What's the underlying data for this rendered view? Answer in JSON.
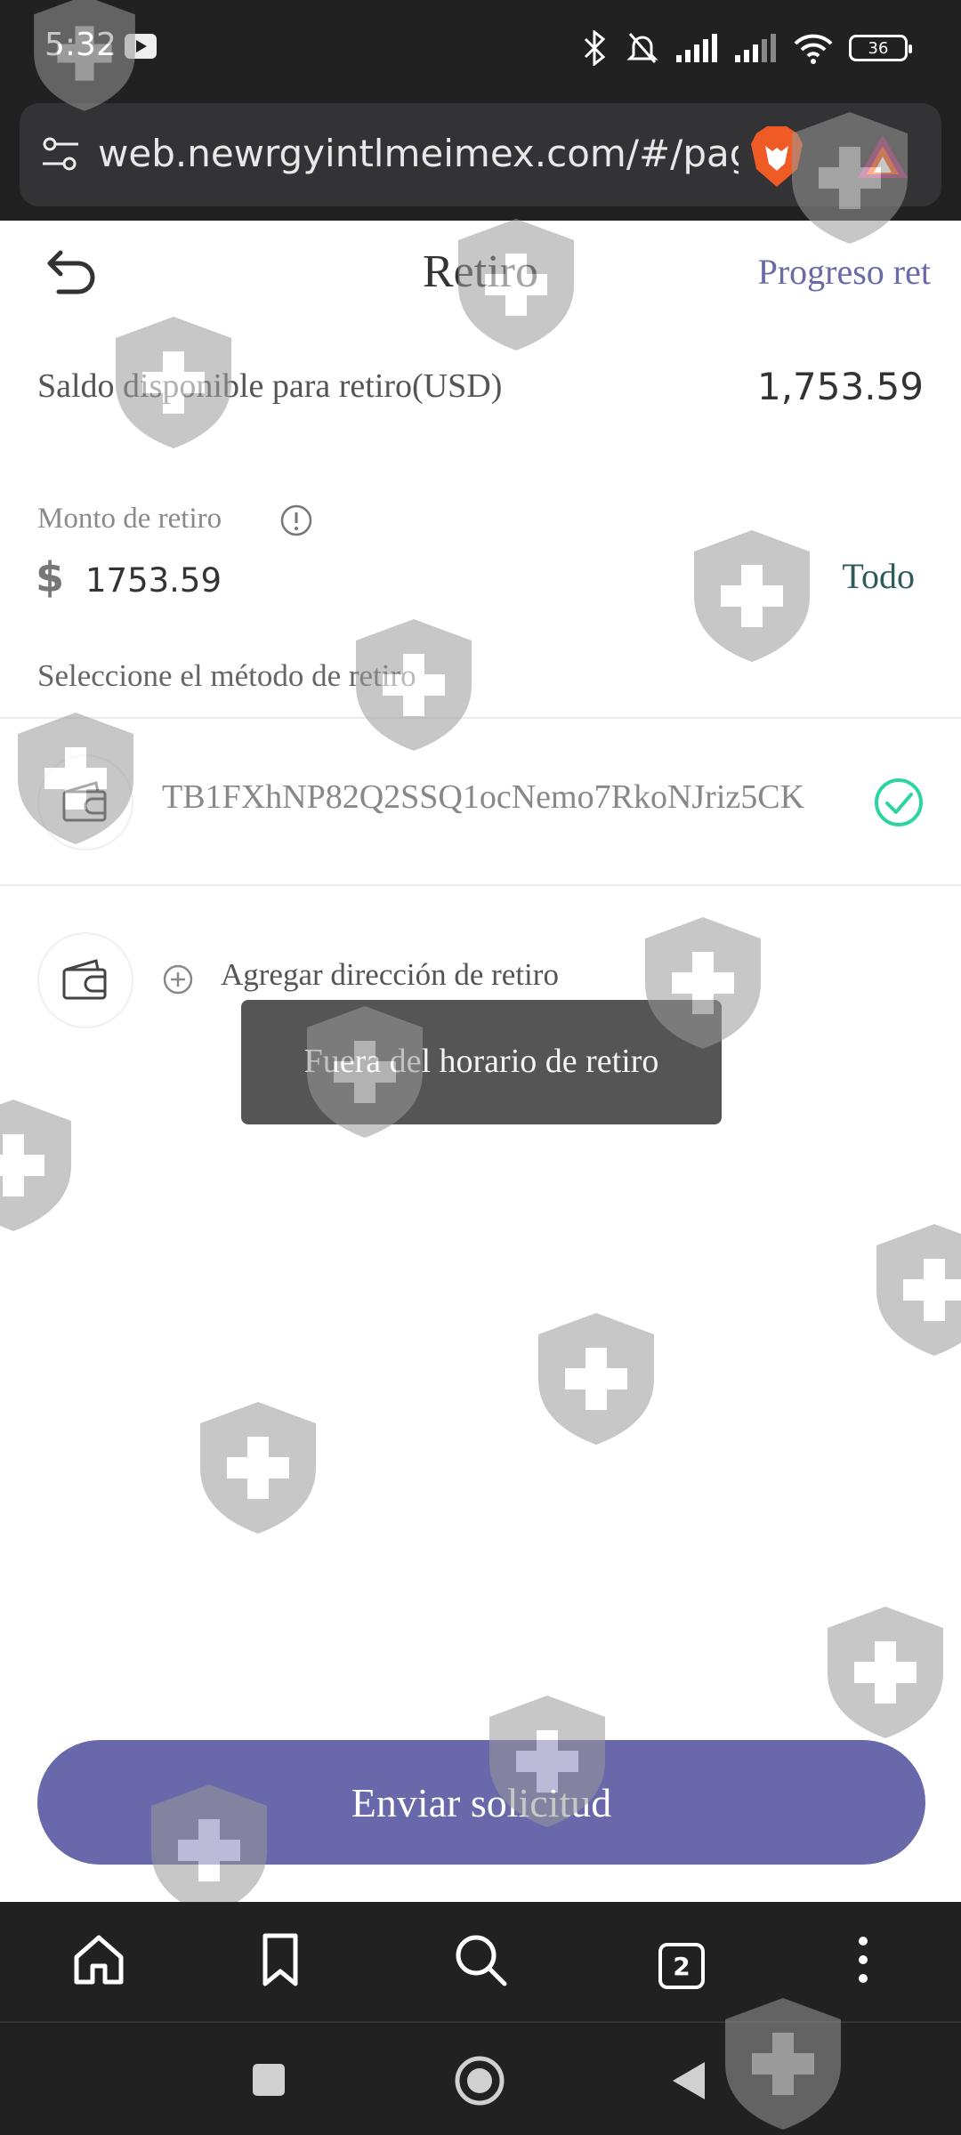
{
  "status_bar": {
    "time": "5:32",
    "battery": "36"
  },
  "browser": {
    "url": "web.newrgyintlmeimex.com/#/page",
    "tab_count": "2"
  },
  "header": {
    "title": "Retiro",
    "progress_link": "Progreso ret"
  },
  "balance": {
    "label": "Saldo disponible para retiro(USD)",
    "value": "1,753.59"
  },
  "amount": {
    "label": "Monto de retiro",
    "currency_symbol": "$",
    "value": "1753.59",
    "all_label": "Todo"
  },
  "method": {
    "label": "Seleccione el método de retiro",
    "selected_address": "TB1FXhNP82Q2SSQ1ocNemo7RkoNJriz5CK",
    "add_label": "Agregar dirección de retiro"
  },
  "toast": {
    "message": "Fuera del horario de retiro"
  },
  "submit": {
    "label": "Enviar solicitud"
  },
  "colors": {
    "accent": "#6868aa",
    "check": "#2bd4a0",
    "dark_bar": "#212121"
  }
}
